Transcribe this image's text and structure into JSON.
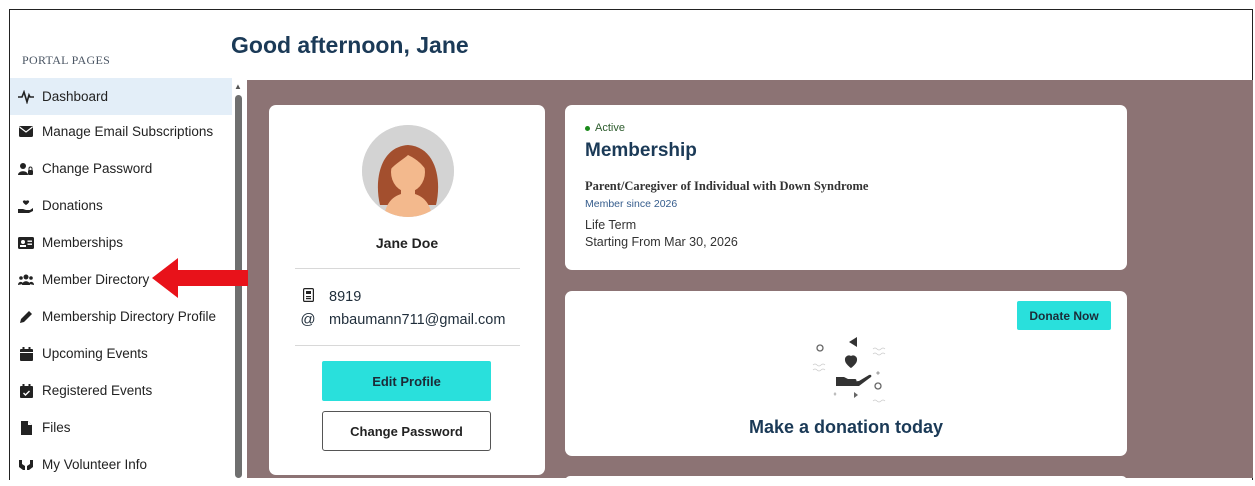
{
  "sidebar": {
    "heading": "PORTAL PAGES",
    "items": [
      {
        "label": "Dashboard",
        "icon": "pulse-icon"
      },
      {
        "label": "Manage Email Subscriptions",
        "icon": "envelope-icon"
      },
      {
        "label": "Change Password",
        "icon": "user-lock-icon"
      },
      {
        "label": "Donations",
        "icon": "hand-holding-icon"
      },
      {
        "label": "Memberships",
        "icon": "id-card-icon"
      },
      {
        "label": "Member Directory",
        "icon": "users-icon"
      },
      {
        "label": "Membership Directory Profile",
        "icon": "pencil-icon"
      },
      {
        "label": "Upcoming Events",
        "icon": "calendar-icon"
      },
      {
        "label": "Registered Events",
        "icon": "calendar-check-icon"
      },
      {
        "label": "Files",
        "icon": "file-icon"
      },
      {
        "label": "My Volunteer Info",
        "icon": "hands-icon"
      }
    ]
  },
  "header": {
    "greeting": "Good afternoon, Jane"
  },
  "profile": {
    "name": "Jane Doe",
    "member_id": "8919",
    "email": "mbaumann711@gmail.com",
    "edit_label": "Edit Profile",
    "change_password_label": "Change Password"
  },
  "membership": {
    "status": "Active",
    "title": "Membership",
    "type": "Parent/Caregiver of Individual with Down Syndrome",
    "since": "Member since 2026",
    "term": "Life Term",
    "start": "Starting From Mar 30, 2026"
  },
  "donation": {
    "button_label": "Donate Now",
    "headline": "Make a donation today"
  },
  "colors": {
    "accent": "#29e0dc",
    "title": "#1b3a57",
    "main_bg": "#8c7374",
    "active_item": "#e3eef8",
    "annotation_arrow": "#e8121a"
  }
}
